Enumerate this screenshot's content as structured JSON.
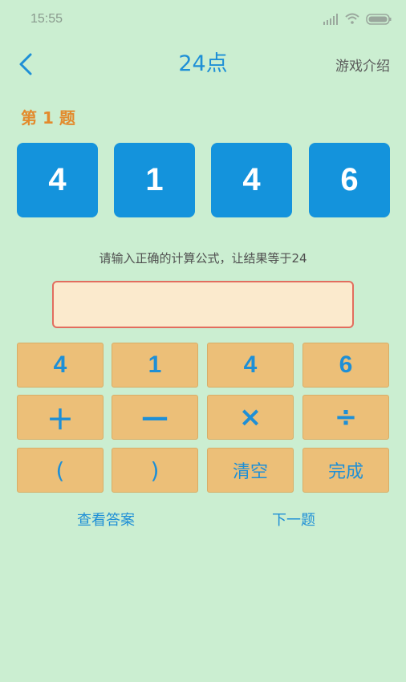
{
  "status_bar": {
    "time": "15:55",
    "icons": [
      "signal-icon",
      "wifi-icon",
      "battery-icon"
    ]
  },
  "header": {
    "back_icon": "chevron-left-icon",
    "title": "24点",
    "intro_label": "游戏介绍"
  },
  "question": {
    "label": "第 1 题",
    "cards": [
      "4",
      "1",
      "4",
      "6"
    ]
  },
  "instruction": "请输入正确的计算公式，让结果等于24",
  "formula_input": {
    "value": "",
    "placeholder": ""
  },
  "keypad": {
    "row1": [
      "4",
      "1",
      "4",
      "6"
    ],
    "row2": [
      "＋",
      "—",
      "×",
      "÷"
    ],
    "row3": [
      "(",
      ")",
      "清空",
      "完成"
    ]
  },
  "footer": {
    "show_answer": "查看答案",
    "next_question": "下一题"
  },
  "colors": {
    "background": "#cbeed1",
    "accent_blue": "#1493dc",
    "key_fill": "#ecbf78",
    "input_fill": "#fbeacd",
    "input_border": "#e26d5e",
    "question_label": "#e38a2c"
  }
}
